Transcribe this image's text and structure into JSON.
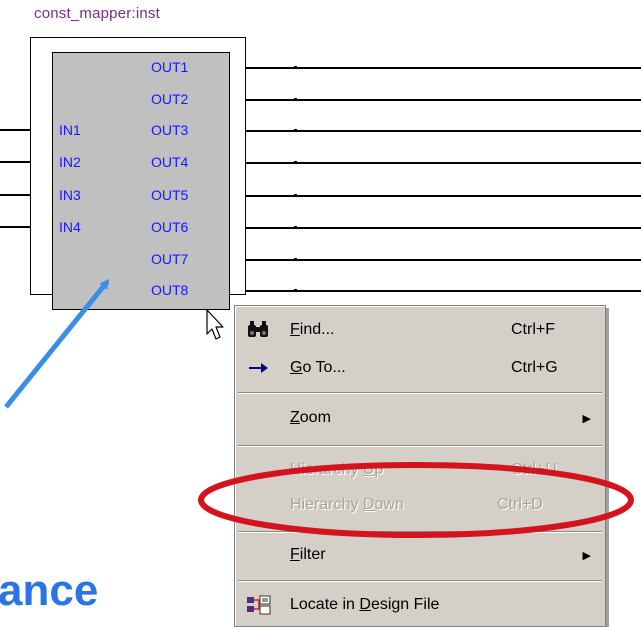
{
  "instance": {
    "name": "const_mapper:inst"
  },
  "inputs": [
    "IN1",
    "IN2",
    "IN3",
    "IN4"
  ],
  "outputs": [
    "OUT1",
    "OUT2",
    "OUT3",
    "OUT4",
    "OUT5",
    "OUT6",
    "OUT7",
    "OUT8"
  ],
  "menu": {
    "items": [
      {
        "pre": "",
        "acc": "F",
        "post": "ind...",
        "shortcut": "Ctrl+F",
        "icon": "binoculars-icon",
        "enabled": true
      },
      {
        "pre": "",
        "acc": "G",
        "post": "o To...",
        "shortcut": "Ctrl+G",
        "icon": "arrow-right-icon",
        "enabled": true
      },
      {
        "pre": "",
        "acc": "Z",
        "post": "oom",
        "shortcut": "",
        "icon": "",
        "submenu": true,
        "enabled": true
      },
      {
        "pre": "Hierarchy ",
        "acc": "U",
        "post": "p",
        "shortcut": "Ctrl+U",
        "icon": "",
        "enabled": false
      },
      {
        "pre": "Hierarchy ",
        "acc": "D",
        "post": "own",
        "shortcut": "Ctrl+D",
        "icon": "",
        "enabled": false
      },
      {
        "pre": "",
        "acc": "F",
        "post": "ilter",
        "shortcut": "",
        "icon": "",
        "submenu": true,
        "enabled": true
      },
      {
        "pre": "Locate in ",
        "acc": "D",
        "post": "esign File",
        "shortcut": "",
        "icon": "locate-in-design-icon",
        "enabled": true
      }
    ],
    "submenu_glyph": "▶"
  },
  "caption_fragment": "ance",
  "colors": {
    "port_text": "#1818ff",
    "instance_label": "#7a2b86",
    "annotation_arrow": "#3a8ee6",
    "highlight_ellipse": "#d4141c",
    "caption": "#2b74e6",
    "block_fill": "#c0c0c0",
    "menu_bg": "#d4d0c8"
  }
}
